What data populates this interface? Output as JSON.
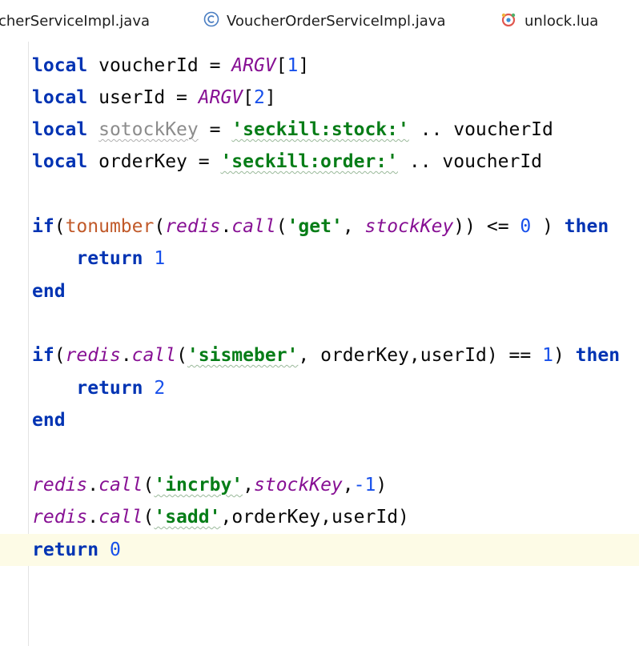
{
  "tabs": [
    {
      "label": "cherServiceImpl.java",
      "icon": "none"
    },
    {
      "label": "VoucherOrderServiceImpl.java",
      "icon": "java-class-icon"
    },
    {
      "label": "unlock.lua",
      "icon": "lua-file-icon"
    }
  ],
  "colors": {
    "keyword": "#0033b3",
    "global": "#871094",
    "number": "#1750eb",
    "string": "#067d17",
    "builtin_function": "#c15a2a",
    "unused": "#8c8c8c",
    "current_line": "#fdfbe6"
  },
  "code_lines": [
    "local voucherId = ARGV[1]",
    "local userId = ARGV[2]",
    "local sotockKey = 'seckill:stock:' .. voucherId",
    "local orderKey = 'seckill:order:' .. voucherId",
    "",
    "if(tonumber(redis.call('get', stockKey)) <= 0 ) then",
    "    return 1",
    "end",
    "",
    "if(redis.call('sismeber', orderKey,userId) == 1) then",
    "    return 2",
    "end",
    "",
    "redis.call('incrby',stockKey,-1)",
    "redis.call('sadd',orderKey,userId)",
    "return 0"
  ],
  "tokens": {
    "local": "local",
    "return": "return",
    "end": "end",
    "if": "if",
    "then": "then",
    "argv": "ARGV",
    "redis": "redis",
    "call": "call",
    "tonumber": "tonumber",
    "voucherId": "voucherId",
    "userId": "userId",
    "sotockKey": "sotockKey",
    "orderKey": "orderKey",
    "stockKey": "stockKey",
    "s_stock": "'seckill:stock:'",
    "s_order": "'seckill:order:'",
    "s_get": "'get'",
    "s_sismeber": "'sismeber'",
    "s_incrby": "'incrby'",
    "s_sadd": "'sadd'",
    "n0": "0",
    "n1": "1",
    "n2": "2",
    "nm1": "-1",
    "p_eq": " = ",
    "p_lb": "[",
    "p_rb": "]",
    "p_concat": " .. ",
    "p_lp": "(",
    "p_rp": ")",
    "p_dot": ".",
    "p_comma_sp": ", ",
    "p_comma": ",",
    "p_sp": " ",
    "p_le": " <= ",
    "p_eqeq": " == ",
    "p_indent": "    ",
    "p_close_then": " ) ",
    "p_rp_sp": ") ",
    "p_rprp": "))"
  }
}
